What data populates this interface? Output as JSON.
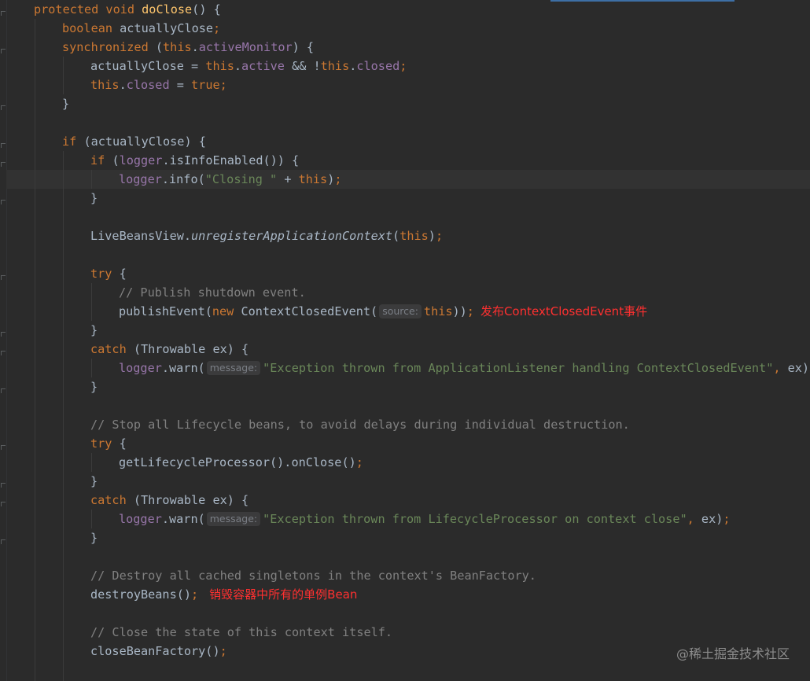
{
  "editor": {
    "language": "java",
    "method_signature": {
      "modifiers": "protected void ",
      "name": "doClose",
      "rest": "() {"
    },
    "lines": {
      "l2": {
        "type": "boolean",
        "rest": " actuallyClose",
        "semi": ";"
      },
      "l3": {
        "kw": "synchronized",
        "p1": " (",
        "this": "this",
        "dot": ".",
        "field": "activeMonitor",
        "p2": ") {"
      },
      "l4": {
        "a": "actuallyClose = ",
        "this1": "this",
        "dot1": ".",
        "f1": "active",
        "mid": " && !",
        "this2": "this",
        "dot2": ".",
        "f2": "closed",
        "semi": ";"
      },
      "l5": {
        "this": "this",
        "dot": ".",
        "field": "closed",
        "eq": " = ",
        "val": "true",
        "semi": ";"
      },
      "l6": {
        "text": "}"
      },
      "l8": {
        "kw": "if",
        "rest": " (actuallyClose) {"
      },
      "l9": {
        "kw": "if",
        "a": " (",
        "field": "logger",
        "b": ".isInfoEnabled()) {"
      },
      "l10": {
        "field": "logger",
        "a": ".info(",
        "str": "\"Closing \"",
        "b": " + ",
        "this": "this",
        "c": ")",
        "semi": ";"
      },
      "l11": {
        "text": "}"
      },
      "l13": {
        "cls": "LiveBeansView.",
        "method": "unregisterApplicationContext",
        "a": "(",
        "this": "this",
        "b": ")",
        "semi": ";"
      },
      "l15": {
        "kw": "try",
        "rest": " {"
      },
      "l16": {
        "comment": "// Publish shutdown event."
      },
      "l17": {
        "a": "publishEvent(",
        "new": "new",
        "b": " ContextClosedEvent(",
        "hint": "source:",
        "this": "this",
        "c": "))",
        "semi": ";",
        "annotation": "发布ContextClosedEvent事件"
      },
      "l18": {
        "text": "}"
      },
      "l19": {
        "kw": "catch",
        "rest": " (Throwable ex) {"
      },
      "l20": {
        "field": "logger",
        "a": ".warn(",
        "hint": "message:",
        "str": "\"Exception thrown from ApplicationListener handling ContextClosedEvent\"",
        "comma": ",",
        "b": " ex)",
        "semi": ";"
      },
      "l21": {
        "text": "}"
      },
      "l23": {
        "comment": "// Stop all Lifecycle beans, to avoid delays during individual destruction."
      },
      "l24": {
        "kw": "try",
        "rest": " {"
      },
      "l25": {
        "a": "getLifecycleProcessor().onClose()",
        "semi": ";"
      },
      "l26": {
        "text": "}"
      },
      "l27": {
        "kw": "catch",
        "rest": " (Throwable ex) {"
      },
      "l28": {
        "field": "logger",
        "a": ".warn(",
        "hint": "message:",
        "str": "\"Exception thrown from LifecycleProcessor on context close\"",
        "comma": ",",
        "b": " ex)",
        "semi": ";"
      },
      "l29": {
        "text": "}"
      },
      "l31": {
        "comment": "// Destroy all cached singletons in the context's BeanFactory."
      },
      "l32": {
        "a": "destroyBeans()",
        "semi": ";",
        "annotation": "销毁容器中所有的单例Bean"
      },
      "l34": {
        "comment": "// Close the state of this context itself."
      },
      "l35": {
        "a": "closeBeanFactory()",
        "semi": ";"
      }
    }
  },
  "watermark": "@稀土掘金技术社区",
  "colors": {
    "background": "#2b2b2b",
    "keyword": "#cc7832",
    "field": "#9876aa",
    "string": "#6a8759",
    "method_decl": "#ffc66d",
    "comment": "#808080",
    "annotation": "#ff3030"
  }
}
